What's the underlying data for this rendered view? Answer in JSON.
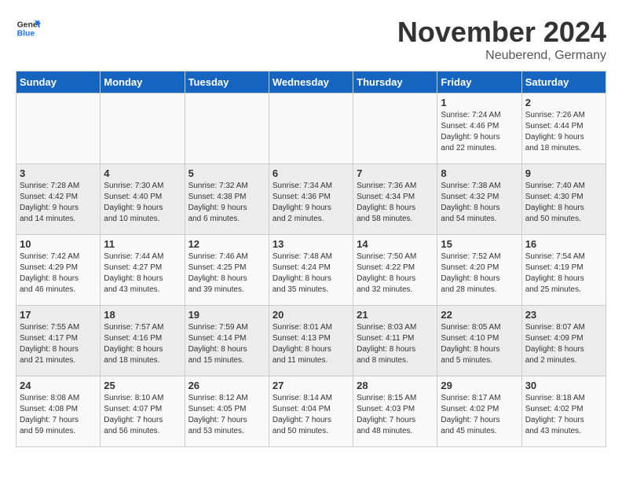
{
  "logo": {
    "line1": "General",
    "line2": "Blue"
  },
  "title": "November 2024",
  "location": "Neuberend, Germany",
  "weekdays": [
    "Sunday",
    "Monday",
    "Tuesday",
    "Wednesday",
    "Thursday",
    "Friday",
    "Saturday"
  ],
  "weeks": [
    [
      {
        "day": "",
        "info": ""
      },
      {
        "day": "",
        "info": ""
      },
      {
        "day": "",
        "info": ""
      },
      {
        "day": "",
        "info": ""
      },
      {
        "day": "",
        "info": ""
      },
      {
        "day": "1",
        "info": "Sunrise: 7:24 AM\nSunset: 4:46 PM\nDaylight: 9 hours\nand 22 minutes."
      },
      {
        "day": "2",
        "info": "Sunrise: 7:26 AM\nSunset: 4:44 PM\nDaylight: 9 hours\nand 18 minutes."
      }
    ],
    [
      {
        "day": "3",
        "info": "Sunrise: 7:28 AM\nSunset: 4:42 PM\nDaylight: 9 hours\nand 14 minutes."
      },
      {
        "day": "4",
        "info": "Sunrise: 7:30 AM\nSunset: 4:40 PM\nDaylight: 9 hours\nand 10 minutes."
      },
      {
        "day": "5",
        "info": "Sunrise: 7:32 AM\nSunset: 4:38 PM\nDaylight: 9 hours\nand 6 minutes."
      },
      {
        "day": "6",
        "info": "Sunrise: 7:34 AM\nSunset: 4:36 PM\nDaylight: 9 hours\nand 2 minutes."
      },
      {
        "day": "7",
        "info": "Sunrise: 7:36 AM\nSunset: 4:34 PM\nDaylight: 8 hours\nand 58 minutes."
      },
      {
        "day": "8",
        "info": "Sunrise: 7:38 AM\nSunset: 4:32 PM\nDaylight: 8 hours\nand 54 minutes."
      },
      {
        "day": "9",
        "info": "Sunrise: 7:40 AM\nSunset: 4:30 PM\nDaylight: 8 hours\nand 50 minutes."
      }
    ],
    [
      {
        "day": "10",
        "info": "Sunrise: 7:42 AM\nSunset: 4:29 PM\nDaylight: 8 hours\nand 46 minutes."
      },
      {
        "day": "11",
        "info": "Sunrise: 7:44 AM\nSunset: 4:27 PM\nDaylight: 8 hours\nand 43 minutes."
      },
      {
        "day": "12",
        "info": "Sunrise: 7:46 AM\nSunset: 4:25 PM\nDaylight: 8 hours\nand 39 minutes."
      },
      {
        "day": "13",
        "info": "Sunrise: 7:48 AM\nSunset: 4:24 PM\nDaylight: 8 hours\nand 35 minutes."
      },
      {
        "day": "14",
        "info": "Sunrise: 7:50 AM\nSunset: 4:22 PM\nDaylight: 8 hours\nand 32 minutes."
      },
      {
        "day": "15",
        "info": "Sunrise: 7:52 AM\nSunset: 4:20 PM\nDaylight: 8 hours\nand 28 minutes."
      },
      {
        "day": "16",
        "info": "Sunrise: 7:54 AM\nSunset: 4:19 PM\nDaylight: 8 hours\nand 25 minutes."
      }
    ],
    [
      {
        "day": "17",
        "info": "Sunrise: 7:55 AM\nSunset: 4:17 PM\nDaylight: 8 hours\nand 21 minutes."
      },
      {
        "day": "18",
        "info": "Sunrise: 7:57 AM\nSunset: 4:16 PM\nDaylight: 8 hours\nand 18 minutes."
      },
      {
        "day": "19",
        "info": "Sunrise: 7:59 AM\nSunset: 4:14 PM\nDaylight: 8 hours\nand 15 minutes."
      },
      {
        "day": "20",
        "info": "Sunrise: 8:01 AM\nSunset: 4:13 PM\nDaylight: 8 hours\nand 11 minutes."
      },
      {
        "day": "21",
        "info": "Sunrise: 8:03 AM\nSunset: 4:11 PM\nDaylight: 8 hours\nand 8 minutes."
      },
      {
        "day": "22",
        "info": "Sunrise: 8:05 AM\nSunset: 4:10 PM\nDaylight: 8 hours\nand 5 minutes."
      },
      {
        "day": "23",
        "info": "Sunrise: 8:07 AM\nSunset: 4:09 PM\nDaylight: 8 hours\nand 2 minutes."
      }
    ],
    [
      {
        "day": "24",
        "info": "Sunrise: 8:08 AM\nSunset: 4:08 PM\nDaylight: 7 hours\nand 59 minutes."
      },
      {
        "day": "25",
        "info": "Sunrise: 8:10 AM\nSunset: 4:07 PM\nDaylight: 7 hours\nand 56 minutes."
      },
      {
        "day": "26",
        "info": "Sunrise: 8:12 AM\nSunset: 4:05 PM\nDaylight: 7 hours\nand 53 minutes."
      },
      {
        "day": "27",
        "info": "Sunrise: 8:14 AM\nSunset: 4:04 PM\nDaylight: 7 hours\nand 50 minutes."
      },
      {
        "day": "28",
        "info": "Sunrise: 8:15 AM\nSunset: 4:03 PM\nDaylight: 7 hours\nand 48 minutes."
      },
      {
        "day": "29",
        "info": "Sunrise: 8:17 AM\nSunset: 4:02 PM\nDaylight: 7 hours\nand 45 minutes."
      },
      {
        "day": "30",
        "info": "Sunrise: 8:18 AM\nSunset: 4:02 PM\nDaylight: 7 hours\nand 43 minutes."
      }
    ]
  ]
}
